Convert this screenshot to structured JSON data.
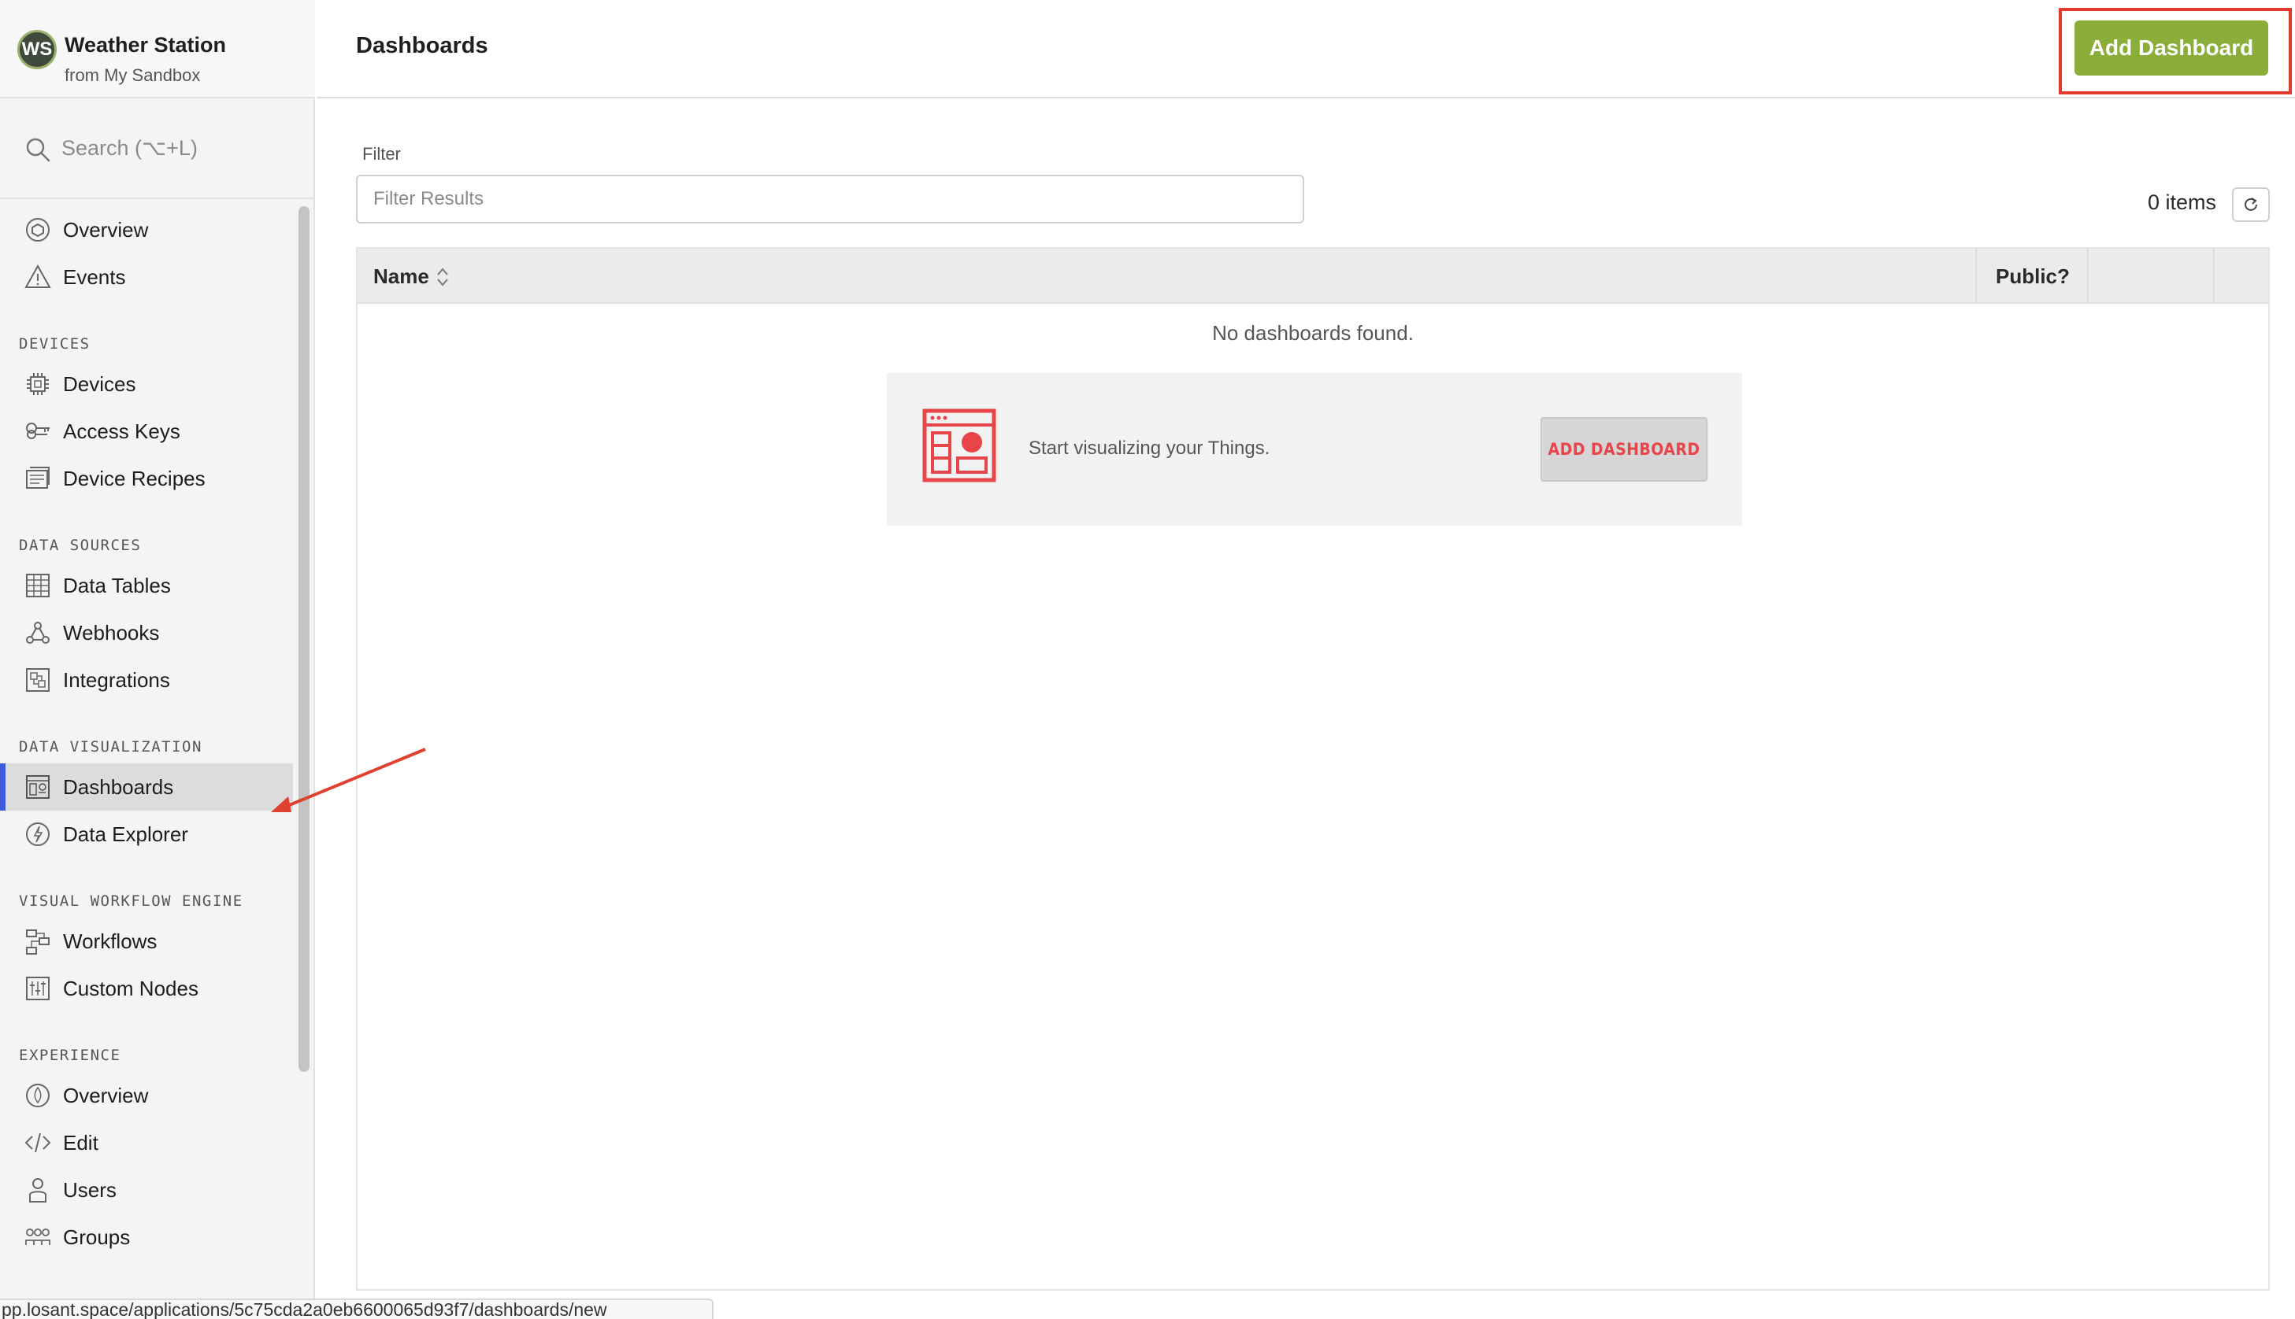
{
  "app": {
    "avatar_initials": "WS",
    "title": "Weather Station",
    "subtitle": "from My Sandbox"
  },
  "search": {
    "placeholder": "Search (⌥+L)"
  },
  "sidebar": {
    "top_items": [
      {
        "label": "Overview",
        "icon": "overview-icon"
      },
      {
        "label": "Events",
        "icon": "warning-triangle-icon"
      }
    ],
    "sections": [
      {
        "title": "DEVICES",
        "items": [
          {
            "label": "Devices",
            "icon": "chip-icon"
          },
          {
            "label": "Access Keys",
            "icon": "key-icon"
          },
          {
            "label": "Device Recipes",
            "icon": "recipe-icon"
          }
        ]
      },
      {
        "title": "DATA SOURCES",
        "items": [
          {
            "label": "Data Tables",
            "icon": "table-icon"
          },
          {
            "label": "Webhooks",
            "icon": "webhook-icon"
          },
          {
            "label": "Integrations",
            "icon": "integration-icon"
          }
        ]
      },
      {
        "title": "DATA VISUALIZATION",
        "items": [
          {
            "label": "Dashboards",
            "icon": "dashboard-icon",
            "active": true
          },
          {
            "label": "Data Explorer",
            "icon": "explorer-icon"
          }
        ]
      },
      {
        "title": "VISUAL WORKFLOW ENGINE",
        "items": [
          {
            "label": "Workflows",
            "icon": "workflow-icon"
          },
          {
            "label": "Custom Nodes",
            "icon": "custom-nodes-icon"
          }
        ]
      },
      {
        "title": "EXPERIENCE",
        "items": [
          {
            "label": "Overview",
            "icon": "experience-overview-icon"
          },
          {
            "label": "Edit",
            "icon": "code-icon"
          },
          {
            "label": "Users",
            "icon": "user-icon"
          },
          {
            "label": "Groups",
            "icon": "groups-icon"
          }
        ]
      }
    ]
  },
  "header": {
    "title": "Dashboards",
    "add_button_label": "Add Dashboard"
  },
  "filter": {
    "label": "Filter",
    "placeholder": "Filter Results",
    "value": ""
  },
  "results": {
    "count_text": "0 items"
  },
  "table": {
    "columns": [
      "Name",
      "Public?"
    ],
    "empty_message": "No dashboards found."
  },
  "empty_card": {
    "text": "Start visualizing your Things.",
    "button_label": "ADD DASHBOARD"
  },
  "status_bar": {
    "url": "pp.losant.space/applications/5c75cda2a0eb6600065d93f7/dashboards/new"
  },
  "colors": {
    "accent_green": "#8bad3a",
    "active_indicator": "#3d5bd9",
    "highlight_red": "#e03b2d",
    "empty_icon_red": "#e8454a"
  }
}
